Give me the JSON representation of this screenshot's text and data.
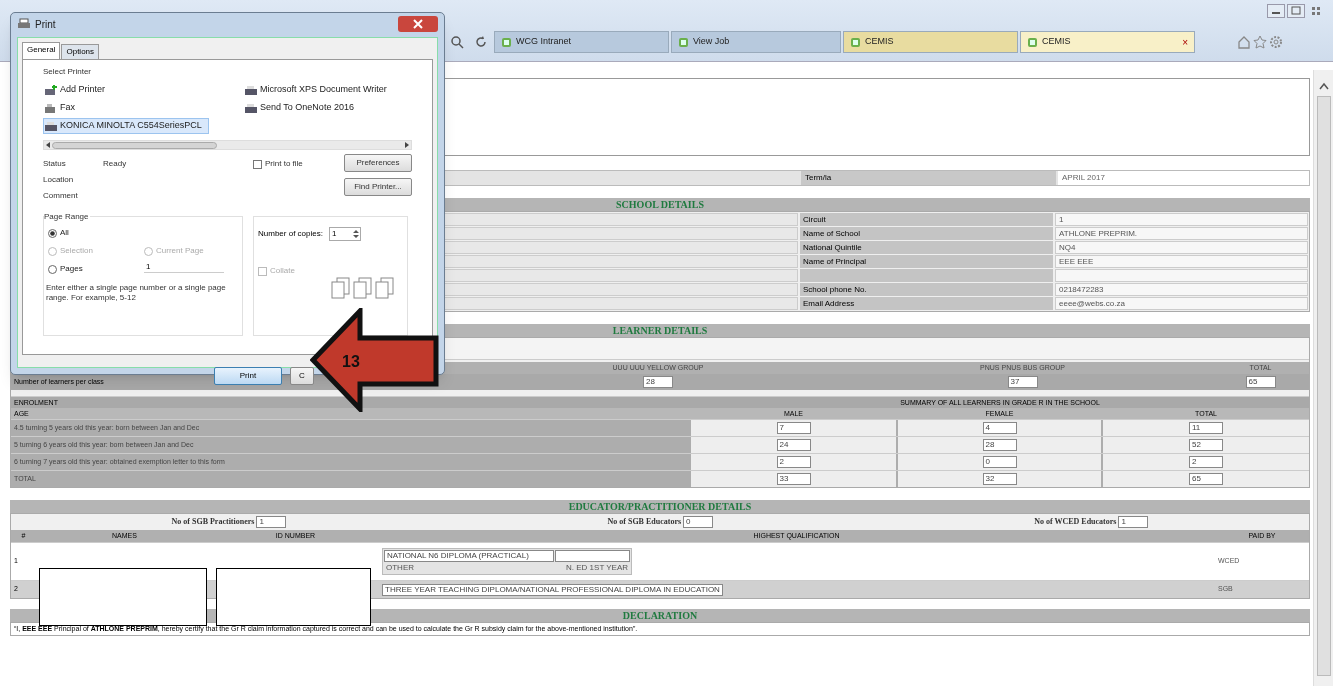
{
  "browser": {
    "tabs": [
      {
        "label": "WCG Intranet",
        "selected": false
      },
      {
        "label": "View Job",
        "selected": false
      },
      {
        "label": "CEMIS",
        "selected": false
      },
      {
        "label": "CEMIS",
        "selected": true
      }
    ],
    "close_tab": "×"
  },
  "form": {
    "term": {
      "label": "Term/la",
      "value": "APRIL 2017"
    },
    "school": {
      "title": "SCHOOL DETAILS",
      "rows": [
        {
          "label": "Circuit",
          "value": "1"
        },
        {
          "label": "Name of School",
          "value": "ATHLONE PREPRIM."
        },
        {
          "label": "National Quintile",
          "value": "NQ4"
        },
        {
          "label": "Name of Principal",
          "value": "EEE EEE"
        },
        {},
        {
          "label": "School phone No.",
          "value": "0218472283"
        },
        {
          "label": "Email Address",
          "value": "eeee@webs.co.za"
        }
      ]
    },
    "learner": {
      "title": "LEARNER DETAILS",
      "columns": [
        "UUU UUU YELLOW GROUP",
        "PNUS PNUS BUS GROUP",
        "TOTAL"
      ],
      "class_row": {
        "label": "Number of learners per class",
        "values": [
          "28",
          "37",
          "65"
        ]
      },
      "enrolment": {
        "label": "ENROLMENT",
        "summary": "SUMMARY OF ALL LEARNERS IN GRADE R IN THE SCHOOL",
        "columns": [
          "AGE",
          "MALE",
          "FEMALE",
          "TOTAL"
        ],
        "rows": [
          {
            "label": "4.5 turning 5 years old this year: born between Jan and Dec",
            "values": [
              "7",
              "4",
              "11"
            ]
          },
          {
            "label": "5 turning 6 years old this year: born between Jan and Dec",
            "values": [
              "24",
              "28",
              "52"
            ]
          },
          {
            "label": "6 turning 7 years old this year: obtained exemption letter to this form",
            "values": [
              "2",
              "0",
              "2"
            ]
          },
          {
            "label": "TOTAL",
            "values": [
              "33",
              "32",
              "65"
            ]
          }
        ]
      }
    },
    "educator": {
      "title": "EDUCATOR/PRACTITIONER DETAILS",
      "counts": [
        {
          "label": "No of SGB Practitioners",
          "value": "1"
        },
        {
          "label": "No of SGB Educators",
          "value": "0"
        },
        {
          "label": "No of WCED Educators",
          "value": "1"
        }
      ],
      "columns": [
        "#",
        "NAMES",
        "ID NUMBER",
        "HIGHEST QUALIFICATION",
        "PAID BY"
      ],
      "rows": [
        {
          "number": "1",
          "qualification": "NATIONAL N6 DIPLOMA (PRACTICAL)",
          "other_label": "OTHER",
          "other_value": "N. ED 1ST YEAR",
          "paid_by": "WCED"
        },
        {
          "number": "2",
          "qualification": "THREE YEAR TEACHING DIPLOMA/NATIONAL PROFESSIONAL DIPLOMA IN EDUCATION",
          "paid_by": "SGB"
        }
      ]
    },
    "declaration": {
      "title": "DECLARATION",
      "text": "“I, **EEE EEE** Principal of **ATHLONE PREPRIM**, hereby certify that the Gr R claim information captured is correct and can be used to calculate the Gr R subsidy claim for the above-mentioned institution”."
    }
  },
  "print_dialog": {
    "title": "Print",
    "tabs": [
      {
        "label": "General",
        "selected": true
      },
      {
        "label": "Options",
        "selected": false
      }
    ],
    "select_printer": "Select Printer",
    "printers": [
      {
        "label": "Add Printer",
        "kind": "add",
        "selected": false
      },
      {
        "label": "Microsoft XPS Document Writer",
        "kind": "printer",
        "selected": false
      },
      {
        "label": "Fax",
        "kind": "fax",
        "selected": false
      },
      {
        "label": "Send To OneNote 2016",
        "kind": "printer",
        "selected": false
      },
      {
        "label": "KONICA MINOLTA C554SeriesPCL",
        "kind": "printer",
        "selected": true
      }
    ],
    "status_label": "Status",
    "status": "Ready",
    "location_label": "Location",
    "comment_label": "Comment",
    "print_to_file": {
      "label": "Print to file",
      "checked": false
    },
    "preferences": "Preferences",
    "find_printer": "Find Printer...",
    "page_range": {
      "title": "Page Range",
      "options": [
        {
          "label": "All",
          "selected": true,
          "disabled": false
        },
        {
          "label": "Selection",
          "selected": false,
          "disabled": true
        },
        {
          "label": "Current Page",
          "selected": false,
          "disabled": true
        },
        {
          "label": "Pages",
          "selected": false,
          "disabled": false
        }
      ],
      "pages_value": "1",
      "hint": "Enter either a single page number or a single page range.  For example, 5-12"
    },
    "copies": {
      "label": "Number of copies:",
      "value": "1"
    },
    "collate": {
      "label": "Collate",
      "checked": false,
      "disabled": true
    },
    "buttons": [
      "Print",
      "C"
    ]
  },
  "annotation": {
    "label": "13"
  }
}
